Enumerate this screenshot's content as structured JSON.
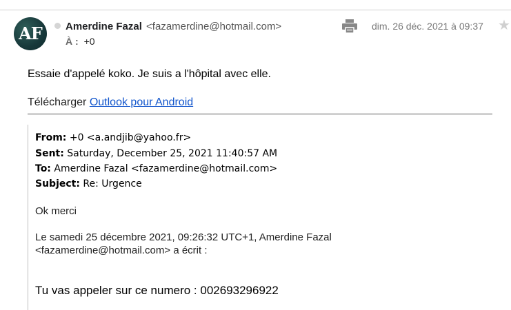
{
  "header": {
    "sender_name": "Amerdine Fazal",
    "sender_email": "<fazamerdine@hotmail.com>",
    "avatar_initials": "AF",
    "to_label": "À :",
    "to_value": "+0",
    "date": "dim. 26 déc. 2021 à 09:37",
    "print_icon": "printer-icon",
    "star_icon": "star-icon"
  },
  "message": {
    "body": "Essaie d'appelé koko. Je suis a l'hôpital avec elle.",
    "download_prefix": "Télécharger ",
    "download_link": "Outlook pour Android"
  },
  "quoted": {
    "from_label": "From:",
    "from_value": " +0 <a.andjib@yahoo.fr>",
    "sent_label": "Sent:",
    "sent_value": " Saturday, December 25, 2021 11:40:57 AM",
    "to_label": "To:",
    "to_value": " Amerdine Fazal <fazamerdine@hotmail.com>",
    "subject_label": "Subject:",
    "subject_value": " Re: Urgence",
    "reply": "Ok merci",
    "attribution_line1": "Le samedi 25 décembre 2021, 09:26:32 UTC+1, Amerdine Fazal",
    "attribution_line2": "<fazamerdine@hotmail.com> a écrit :",
    "original_text": "Tu vas appeler sur ce numero : 002693296922"
  },
  "colors": {
    "link": "#1155cc",
    "avatar_bg": "#17383a",
    "muted_text": "#777777"
  }
}
